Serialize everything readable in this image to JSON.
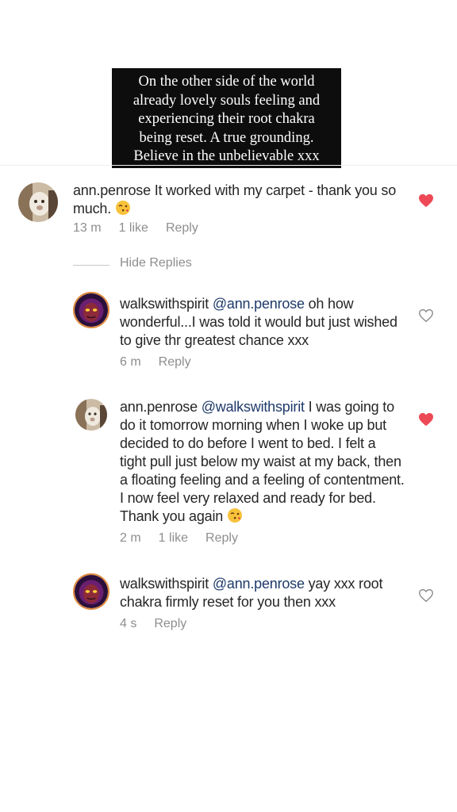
{
  "caption": {
    "lines": [
      "On the other side of the world",
      "already lovely souls feeling and",
      "experiencing their root chakra",
      "being reset. A true grounding.",
      "Believe in the unbelievable xxx"
    ]
  },
  "comments": [
    {
      "username": "ann.penrose",
      "mention": "",
      "text_lines": [
        "It worked with my carpet - thank you so",
        "much."
      ],
      "emoji": "kiss-face",
      "time": "13 m",
      "likes": "1 like",
      "reply_label": "Reply",
      "liked": true
    },
    {
      "username": "walkswithspirit",
      "mention": "@ann.penrose",
      "text_lines": [
        "oh how",
        "wonderful...I was told it would but just wished",
        "to give thr greatest chance xxx"
      ],
      "time": "6 m",
      "likes": "",
      "reply_label": "Reply",
      "liked": false
    },
    {
      "username": "ann.penrose",
      "mention": "@walkswithspirit",
      "text_lines": [
        "I was going to",
        "do it tomorrow morning when I woke up but",
        "decided to do before I went to bed.  I felt a",
        "tight pull just below my waist at my back, then",
        "a floating feeling and a feeling of contentment.",
        "I now feel very relaxed and ready for bed.",
        "Thank you again"
      ],
      "emoji": "kiss-face",
      "time": "2 m",
      "likes": "1 like",
      "reply_label": "Reply",
      "liked": true
    },
    {
      "username": "walkswithspirit",
      "mention": "@ann.penrose",
      "text_lines": [
        "yay xxx root",
        "chakra firmly reset for you then xxx"
      ],
      "time": "4 s",
      "likes": "",
      "reply_label": "Reply",
      "liked": false
    }
  ],
  "hide_replies_label": "Hide Replies",
  "colors": {
    "liked_heart": "#ed4956",
    "mention": "#1e3a6b",
    "meta": "#8e8e8e"
  }
}
